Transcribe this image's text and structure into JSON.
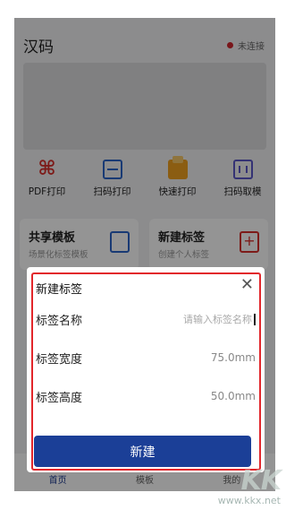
{
  "app": {
    "title": "汉码",
    "connection_status": "未连接",
    "status_color": "#d0262e"
  },
  "quick_actions": [
    {
      "label": "PDF打印",
      "icon": "pdf-icon"
    },
    {
      "label": "扫码打印",
      "icon": "scan-print-icon"
    },
    {
      "label": "快速打印",
      "icon": "printer-icon"
    },
    {
      "label": "扫码取模",
      "icon": "scan-template-icon"
    }
  ],
  "cards": [
    {
      "title": "共享模板",
      "subtitle": "场景化标签模板",
      "icon": "share-template-icon"
    },
    {
      "title": "新建标签",
      "subtitle": "创建个人标签",
      "icon": "new-label-icon"
    }
  ],
  "bottom_nav": [
    {
      "label": "首页",
      "active": true
    },
    {
      "label": "模板",
      "active": false
    },
    {
      "label": "我的",
      "active": false
    }
  ],
  "dialog": {
    "title": "新建标签",
    "close_icon": "close-icon",
    "name_label": "标签名称",
    "name_placeholder": "请输入标签名称",
    "width_label": "标签宽度",
    "width_value": "75.0mm",
    "height_label": "标签高度",
    "height_value": "50.0mm",
    "create_button": "新建"
  },
  "watermark": {
    "url": "www.kkx.net"
  },
  "colors": {
    "primary": "#1b3f97",
    "highlight_border": "#e2262b"
  }
}
